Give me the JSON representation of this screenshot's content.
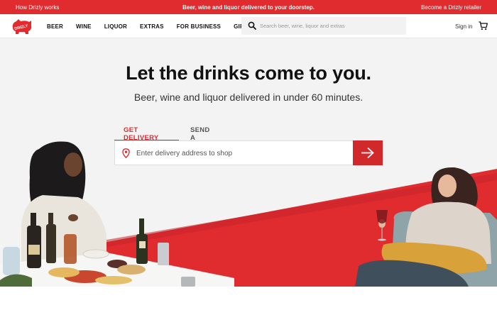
{
  "promo": {
    "left_link": "How Drizly works",
    "center_text": "Beer, wine and liquor delivered to your doorstep.",
    "right_link": "Become a Drizly retailer"
  },
  "brand": {
    "logo_text": "DRIZLY",
    "accent": "#e02b2f"
  },
  "nav": {
    "items": [
      "BEER",
      "WINE",
      "LIQUOR",
      "EXTRAS",
      "FOR BUSINESS",
      "GIFTS"
    ]
  },
  "search": {
    "placeholder": "Search beer, wine, liquor and extras",
    "icon": "search-icon"
  },
  "account": {
    "signin": "Sign in",
    "cart_icon": "cart-icon"
  },
  "hero": {
    "title": "Let the drinks come to you.",
    "subtitle": "Beer, wine and liquor delivered in under 60 minutes."
  },
  "delivery": {
    "tabs": [
      {
        "label": "GET DELIVERY",
        "active": true
      },
      {
        "label": "SEND A GIFT",
        "active": false
      }
    ],
    "address_placeholder": "Enter delivery address to shop",
    "submit_icon": "arrow-right-icon"
  }
}
